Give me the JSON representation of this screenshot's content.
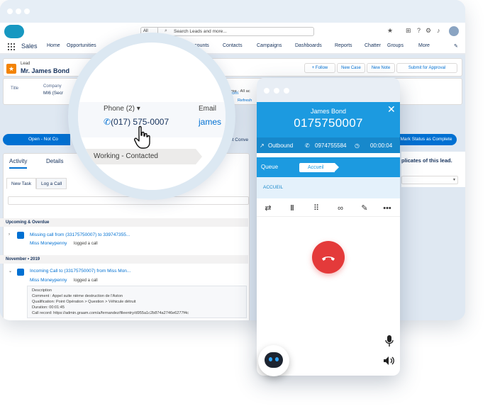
{
  "salesforce": {
    "app_name": "Sales",
    "search": {
      "scope": "All",
      "placeholder": "Search Leads and more..."
    },
    "nav": [
      "Home",
      "Opportunities",
      "Accounts",
      "Contacts",
      "Campaigns",
      "Dashboards",
      "Reports",
      "Chatter",
      "Groups",
      "More"
    ],
    "lead": {
      "type": "Lead",
      "name": "Mr. James Bond",
      "buttons": [
        "+ Follow",
        "New Case",
        "New Note",
        "Submit for Approval"
      ],
      "title_label": "Title",
      "company_label": "Company",
      "company_value": "MI6 (Secr",
      "email_tail": "om"
    },
    "path": {
      "open_label": "Open - Not Co",
      "mid_label": "d - Not Conve",
      "mark_label": "Mark Status as Complete"
    },
    "activity": {
      "tabs": [
        "Activity",
        "Details"
      ],
      "subtabs": [
        "New Task",
        "Log a Call"
      ],
      "filters": "Filters: All time · All ac",
      "refresh": "Refresh",
      "upcoming": "Upcoming & Overdue",
      "item1_link": "Missing call from (33175750007) to 339747355...",
      "item1_by": "Miss Moneypenny",
      "item1_action": "logged a call",
      "month": "November • 2019",
      "item2_link": "Incoming Call to (33175750007) from Miss Mon...",
      "item2_by": "Miss Moneypenny",
      "item2_action": "logged a call",
      "desc": [
        "Description",
        "Comment : Appel suite nième destruction de l'Aston",
        "Qualification: Point Opération > Question > Véhicule détruit",
        "Duration: 00:01:45",
        "Call record: https://admin.graam.com/a/fernandez/fileentry/d955a1c2b874a2746e6277f4c"
      ]
    },
    "duplicates_text": "plicates of this lead."
  },
  "magnifier": {
    "phone_label": "Phone (2) ▾",
    "phone_value": "(017) 575-0007",
    "email_label": "Email",
    "email_value": "james",
    "status": "Working - Contacted"
  },
  "softphone": {
    "caller_name": "James Bond",
    "caller_number": "0175750007",
    "direction": "Outbound",
    "line": "0974755584",
    "timer": "00:00:04",
    "queue_label": "Queue",
    "queue_value": "Accueil",
    "queue_name": "ACCUEIL",
    "controls": [
      "transfer-icon",
      "pause-icon",
      "keypad-icon",
      "voicemail-icon",
      "edit-icon",
      "more-icon"
    ]
  },
  "colors": {
    "brand_blue": "#1c9ae0",
    "dark_blue": "#1788cb",
    "hangup_red": "#e43a3a",
    "salesforce_blue": "#0070d2",
    "lead_orange": "#f38303"
  }
}
